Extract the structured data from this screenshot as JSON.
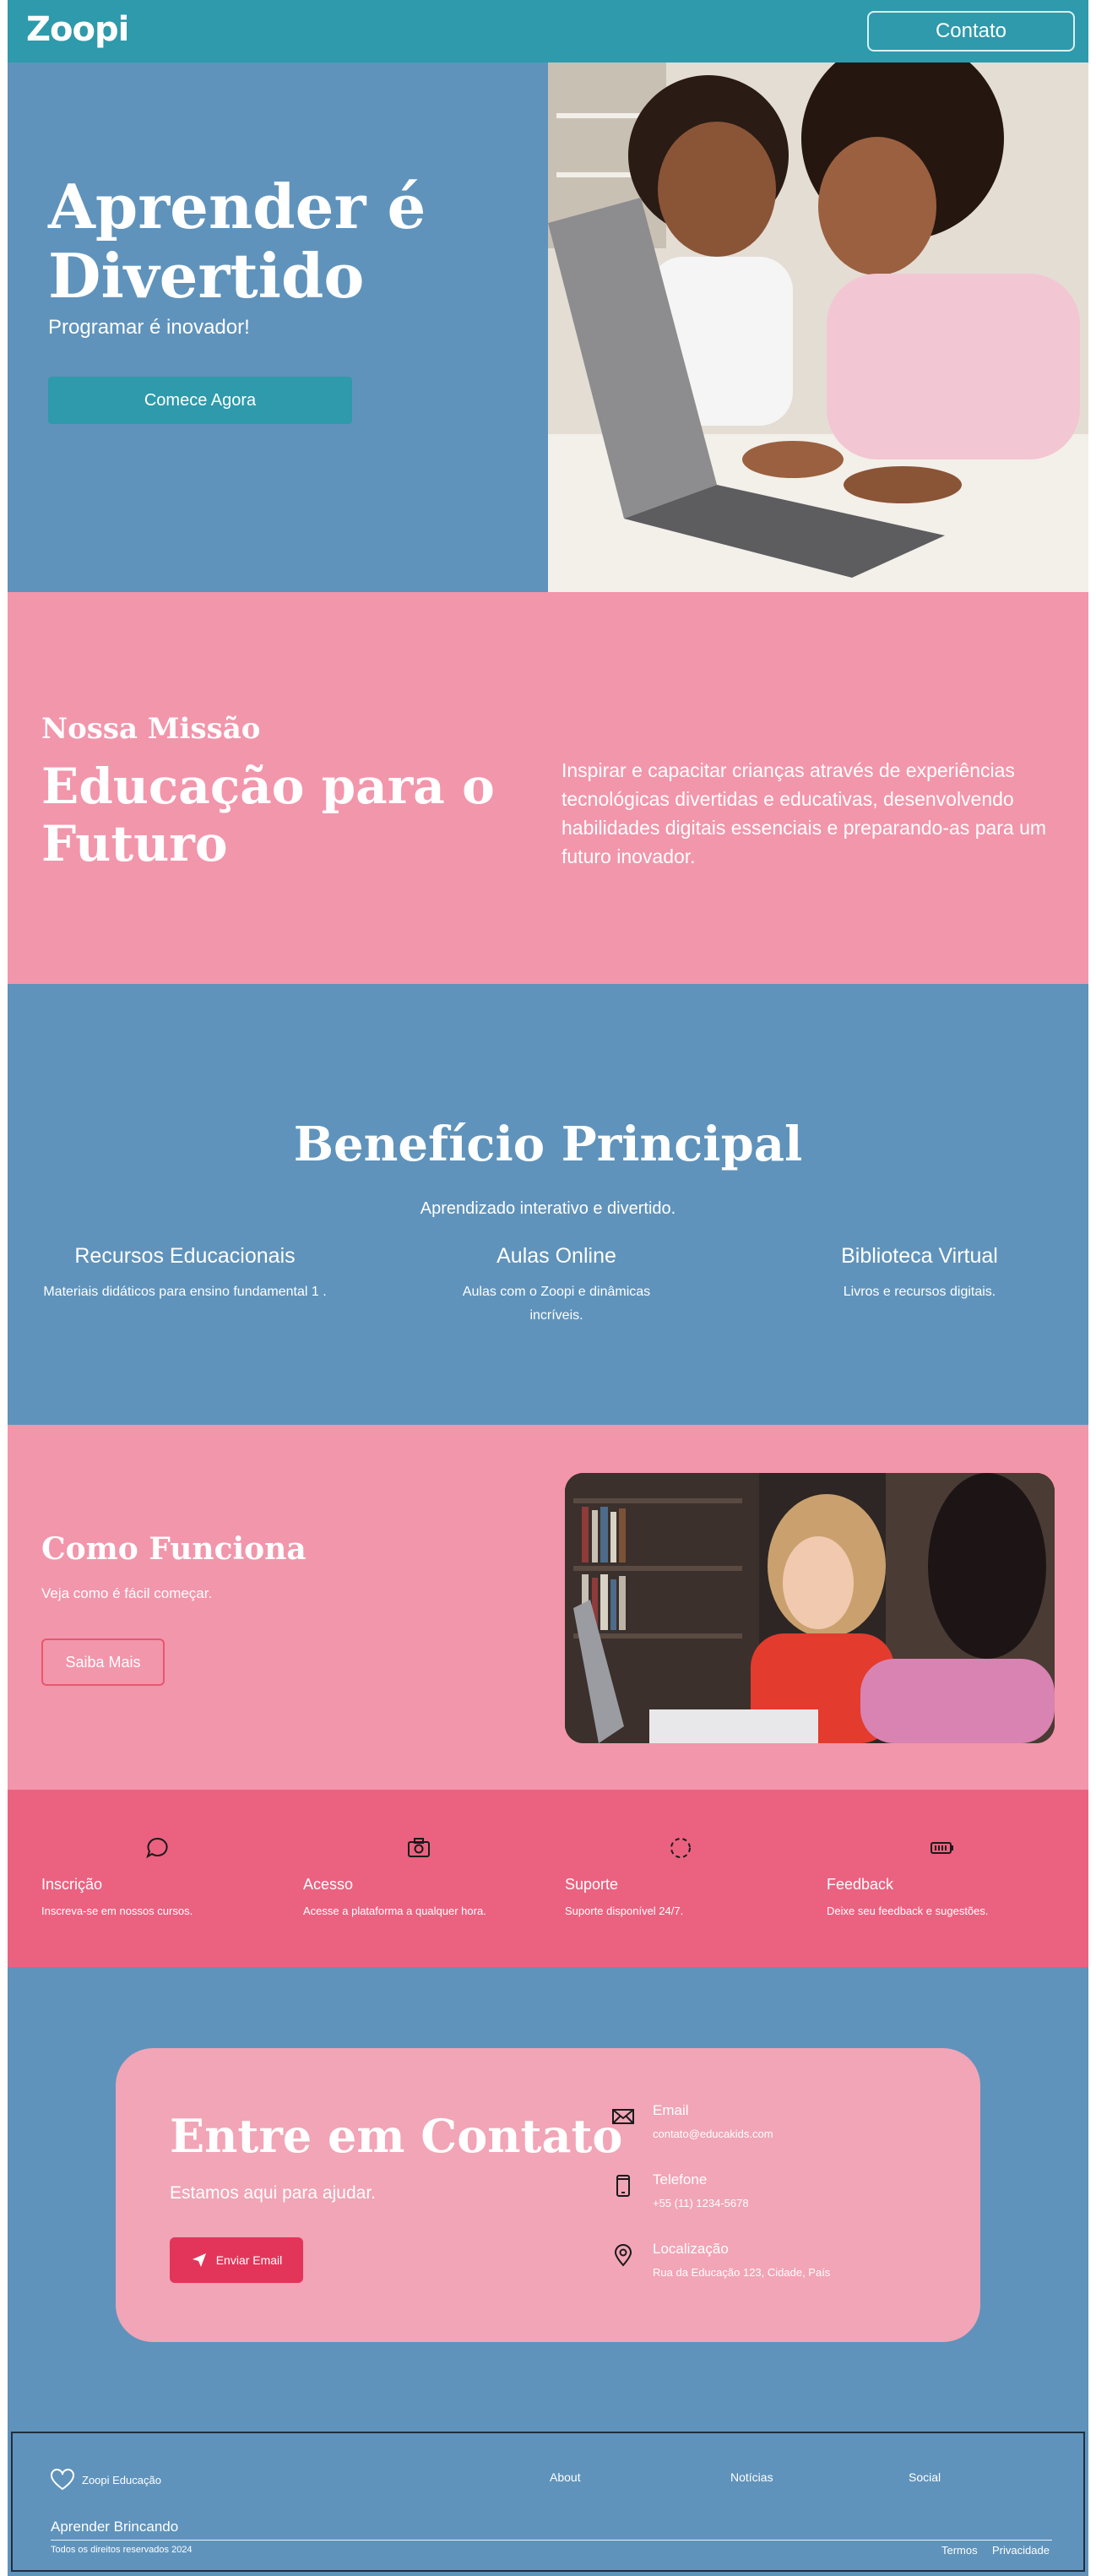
{
  "header": {
    "logo": "Zoopi",
    "contato_label": "Contato"
  },
  "hero": {
    "title": "Aprender é Divertido",
    "subtitle": "Programar é inovador!",
    "cta_label": "Comece Agora"
  },
  "missao": {
    "kicker": "Nossa Missão",
    "title": "Educação para o Futuro",
    "text": "Inspirar e capacitar crianças através de experiências tecnológicas divertidas e educativas, desenvolvendo habilidades digitais essenciais e preparando-as para um futuro inovador."
  },
  "beneficio": {
    "title": "Benefício Principal",
    "subtitle": "Aprendizado interativo e divertido.",
    "cols": [
      {
        "title": "Recursos Educacionais",
        "text": "Materiais didáticos para ensino fundamental 1 ."
      },
      {
        "title": "Aulas Online",
        "text": "Aulas com o Zoopi e dinâmicas incríveis."
      },
      {
        "title": "Biblioteca Virtual",
        "text": "Livros e recursos digitais."
      }
    ]
  },
  "como": {
    "title": "Como Funciona",
    "subtitle": "Veja como é fácil começar.",
    "cta_label": "Saiba Mais"
  },
  "features": [
    {
      "icon": "chat-bubble-icon",
      "title": "Inscrição",
      "text": "Inscreva-se em nossos cursos."
    },
    {
      "icon": "camera-icon",
      "title": "Acesso",
      "text": "Acesse a plataforma a qualquer hora."
    },
    {
      "icon": "dashed-circle-icon",
      "title": "Suporte",
      "text": "Suporte disponível 24/7."
    },
    {
      "icon": "battery-icon",
      "title": "Feedback",
      "text": "Deixe seu feedback e sugestões."
    }
  ],
  "contato": {
    "title": "Entre em Contato",
    "subtitle": "Estamos aqui para ajudar.",
    "email_btn": "Enviar Email",
    "items": [
      {
        "icon": "envelope-icon",
        "label": "Email",
        "value": "contato@educakids.com"
      },
      {
        "icon": "phone-icon",
        "label": "Telefone",
        "value": "+55 (11) 1234-5678"
      },
      {
        "icon": "location-pin-icon",
        "label": "Localização",
        "value": "Rua da Educação 123, Cidade, País"
      }
    ]
  },
  "footer": {
    "brand": "Zoopi Educação",
    "links": [
      "About",
      "Notícias",
      "Social"
    ],
    "tagline": "Aprender Brincando",
    "copyright": "Todos os direitos reservados 2024",
    "legal": [
      "Termos",
      "Privacidade"
    ]
  },
  "colors": {
    "teal": "#2e9aab",
    "blue": "#5f93bb",
    "pink": "#f296ab",
    "dark_pink": "#ea6280",
    "card_pink": "#f1a5b6",
    "button_red": "#e3355a"
  }
}
